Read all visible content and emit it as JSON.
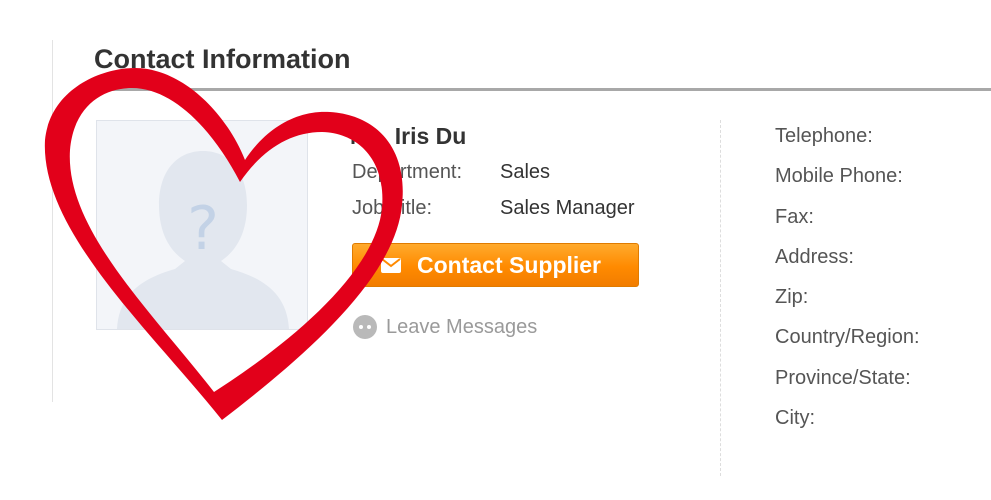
{
  "section": {
    "title": "Contact Information"
  },
  "contact": {
    "name": "Ms. Iris Du",
    "fields": [
      {
        "label": "Department:",
        "value": "Sales"
      },
      {
        "label": "Job Title:",
        "value": "Sales Manager"
      }
    ],
    "contact_button_label": "Contact Supplier",
    "leave_messages_label": "Leave Messages",
    "avatar_icon": "unknown-person-avatar"
  },
  "details": {
    "labels": [
      "Telephone:",
      "Mobile Phone:",
      "Fax:",
      "Address:",
      "Zip:",
      "Country/Region:",
      "Province/State:",
      "City:"
    ]
  },
  "overlay": {
    "icon": "heart-outline",
    "color": "#e2001a"
  },
  "colors": {
    "button_orange": "#ff8a00",
    "text_dark": "#333333",
    "text_muted": "#9a9a9a"
  }
}
